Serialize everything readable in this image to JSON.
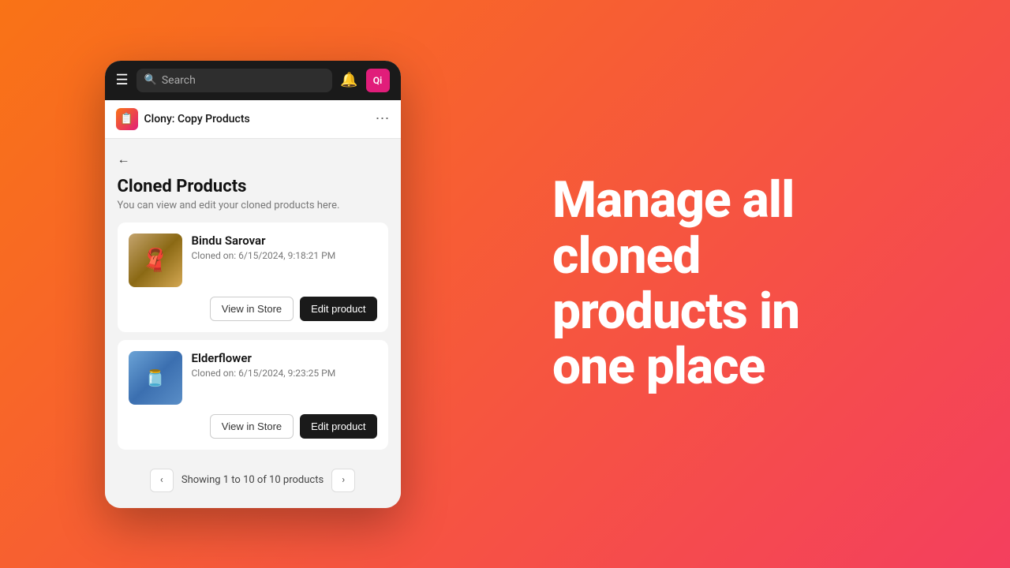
{
  "background": {
    "gradient_start": "#f97316",
    "gradient_end": "#f43f5e"
  },
  "topbar": {
    "search_placeholder": "Search",
    "avatar_label": "Qi"
  },
  "app_header": {
    "app_name": "Clony: Copy Products",
    "more_icon": "⋯"
  },
  "main": {
    "page_title": "Cloned Products",
    "page_subtitle": "You can view and edit your cloned products here.",
    "products": [
      {
        "name": "Bindu Sarovar",
        "cloned_on": "Cloned on: 6/15/2024, 9:18:21 PM",
        "image_type": "sarovar"
      },
      {
        "name": "Elderflower",
        "cloned_on": "Cloned on: 6/15/2024, 9:23:25 PM",
        "image_type": "elderflower"
      }
    ],
    "view_button_label": "View in Store",
    "edit_button_label": "Edit product",
    "pagination": {
      "text": "Showing 1 to 10 of 10 products",
      "prev": "‹",
      "next": "›"
    }
  },
  "hero": {
    "line1": "Manage all",
    "line2": "cloned",
    "line3": "products in",
    "line4": "one place"
  }
}
